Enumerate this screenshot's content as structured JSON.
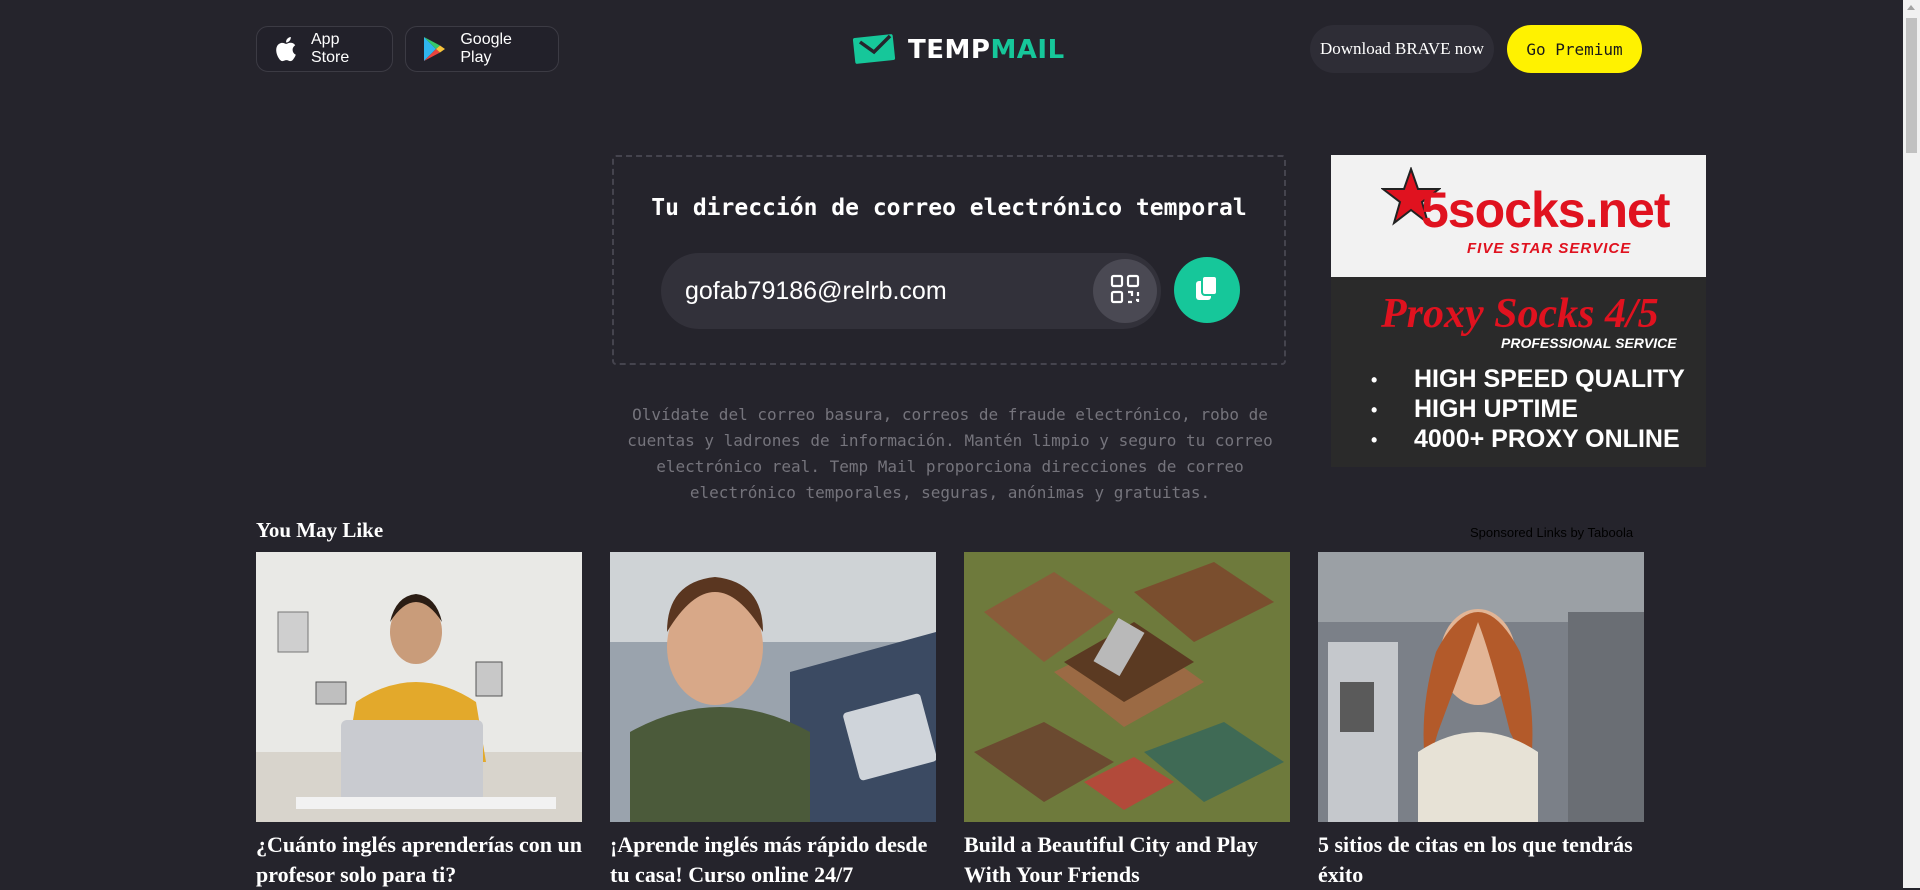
{
  "header": {
    "app_store_label": "App Store",
    "google_play_label": "Google Play",
    "logo_text_a": "TEMP",
    "logo_text_b": "MAIL",
    "brave_label": "Download BRAVE now",
    "premium_label": "Go Premium"
  },
  "email": {
    "title": "Tu dirección de correo electrónico temporal",
    "address": "gofab79186@relrb.com"
  },
  "description": "Olvídate del correo basura, correos de fraude electrónico, robo de cuentas y ladrones de información. Mantén limpio y seguro tu correo electrónico real. Temp Mail proporciona direcciones de correo electrónico temporales, seguras, anónimas y gratuitas.",
  "ad": {
    "logo_text": "5socks.net",
    "tagline": "FIVE STAR SERVICE",
    "headline": "Proxy Socks 4/5",
    "subheadline": "PROFESSIONAL SERVICE",
    "features": [
      "HIGH SPEED QUALITY",
      "HIGH UPTIME",
      "4000+ PROXY ONLINE"
    ]
  },
  "feed": {
    "heading": "You May Like",
    "sponsored": "Sponsored Links by Taboola",
    "cards": [
      {
        "title": "¿Cuánto inglés aprenderías con un profesor solo para ti?"
      },
      {
        "title": "¡Aprende inglés más rápido desde tu casa! Curso online 24/7"
      },
      {
        "title": "Build a Beautiful City and Play With Your Friends"
      },
      {
        "title": "5 sitios de citas en los que tendrás éxito"
      }
    ]
  },
  "colors": {
    "background": "#25242c",
    "accent_green": "#16c79a",
    "premium_yellow": "#fff200",
    "ad_red": "#e0121f"
  }
}
